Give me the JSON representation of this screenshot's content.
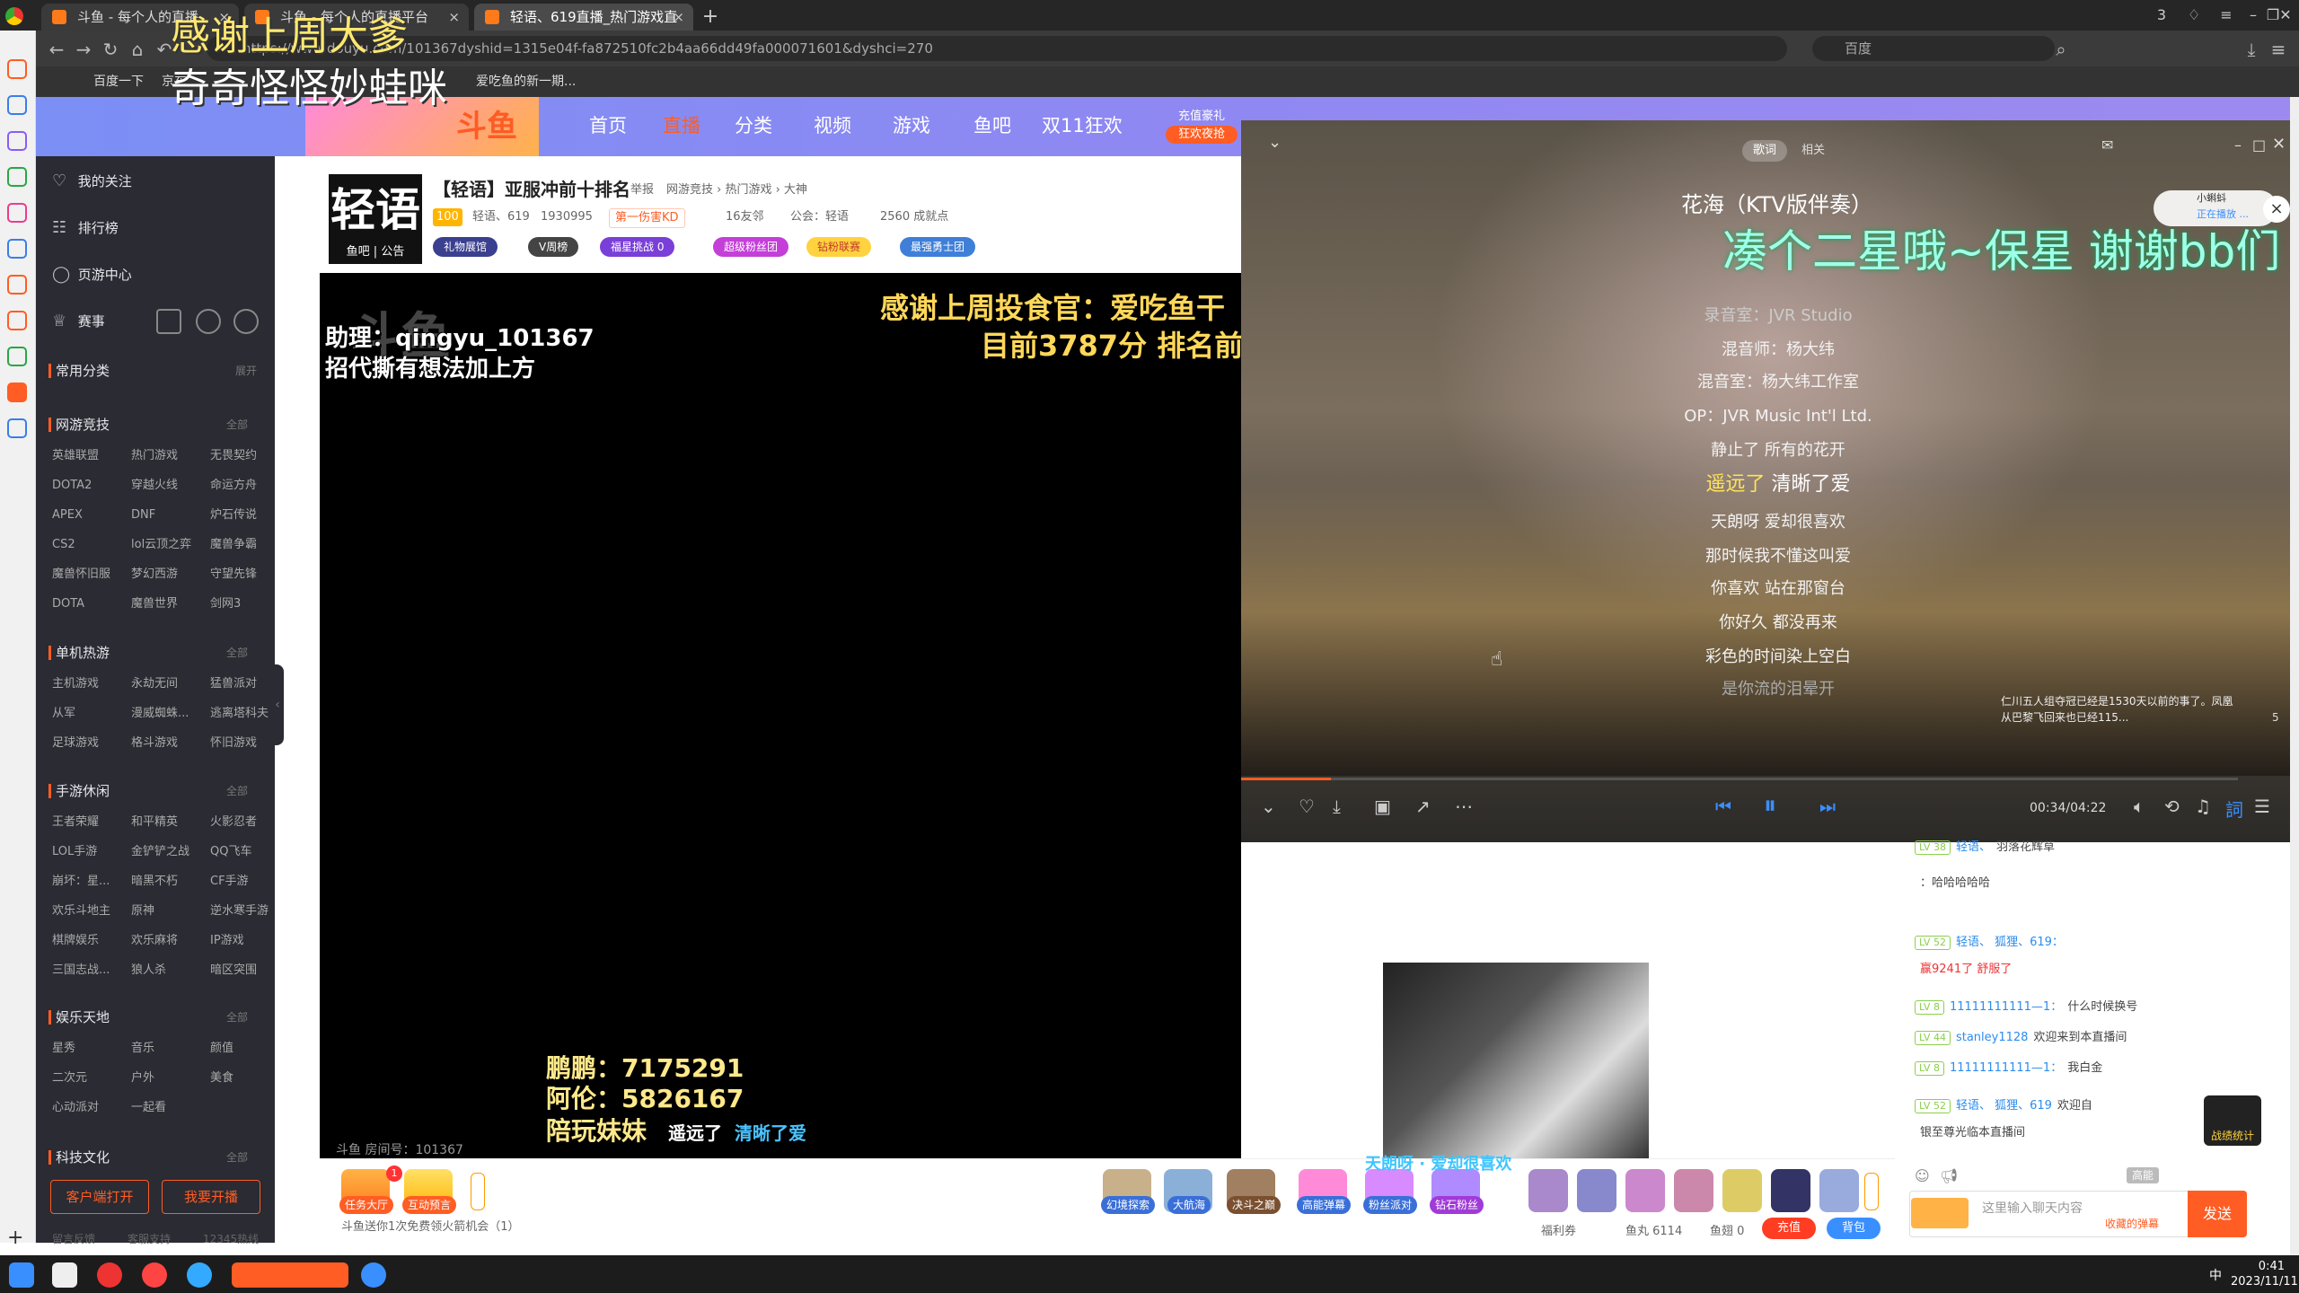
{
  "browser": {
    "tabs": [
      {
        "label": "斗鱼 - 每个人的直播"
      },
      {
        "label": "斗鱼 - 每个人的直播平台"
      },
      {
        "label": "轻语、619直播_热门游戏直"
      }
    ],
    "url": "https://www.douyu.com/101367dyshid=1315e04f-fa872510fc2b4aa66dd49fa000071601&dyshci=270",
    "search_placeholder": "百度",
    "bookmarks": [
      "百度一下",
      "京东",
      "爱吃鱼的新一期..."
    ],
    "tab_count": "3"
  },
  "overlay": {
    "line1": "感谢上周大爹",
    "line2": "奇奇怪怪妙蛙咪"
  },
  "site": {
    "logo": "斗鱼",
    "nav": [
      "首页",
      "直播",
      "分类",
      "视频",
      "游戏",
      "鱼吧",
      "双11狂欢"
    ],
    "promo": [
      "充值豪礼",
      "狂欢夜抢"
    ]
  },
  "sidebar": {
    "top": [
      "我的关注",
      "排行榜",
      "页游中心",
      "赛事"
    ],
    "common": {
      "title": "常用分类",
      "more": "展开"
    },
    "sections": [
      {
        "title": "网游竞技",
        "more": "全部",
        "items": [
          "英雄联盟",
          "热门游戏",
          "无畏契约",
          "DOTA2",
          "穿越火线",
          "命运方舟",
          "APEX",
          "DNF",
          "炉石传说",
          "CS2",
          "lol云顶之弈",
          "魔兽争霸",
          "魔兽怀旧服",
          "梦幻西游",
          "守望先锋",
          "DOTA",
          "魔兽世界",
          "剑网3"
        ]
      },
      {
        "title": "单机热游",
        "more": "全部",
        "items": [
          "主机游戏",
          "永劫无间",
          "猛兽派对",
          "从军",
          "漫威蜘蛛...",
          "逃离塔科夫",
          "足球游戏",
          "格斗游戏",
          "怀旧游戏"
        ]
      },
      {
        "title": "手游休闲",
        "more": "全部",
        "items": [
          "王者荣耀",
          "和平精英",
          "火影忍者",
          "LOL手游",
          "金铲铲之战",
          "QQ飞车",
          "崩坏：星...",
          "暗黑不朽",
          "CF手游",
          "欢乐斗地主",
          "原神",
          "逆水寒手游",
          "棋牌娱乐",
          "欢乐麻将",
          "IP游戏",
          "三国志战...",
          "狼人杀",
          "暗区突围"
        ]
      },
      {
        "title": "娱乐天地",
        "more": "全部",
        "items": [
          "星秀",
          "音乐",
          "颜值",
          "二次元",
          "户外",
          "美食",
          "心动派对",
          "一起看"
        ]
      },
      {
        "title": "科技文化",
        "more": "全部",
        "items": []
      }
    ],
    "client_btn": "客户端打开",
    "live_btn": "我要开播",
    "footer": [
      "留言反馈",
      "客服支持",
      "12345热线"
    ]
  },
  "room": {
    "avatar_text": "轻语",
    "avatar_sub": "鱼吧 | 公告",
    "title": "【轻语】亚服冲前十排名",
    "report": "举报",
    "category": "网游竞技 › 热门游戏 › 大神",
    "level": "100",
    "anchor": "轻语、619",
    "hot": "1930995",
    "rank": "第一伤害KD",
    "friends": "16友邻",
    "guild": "公会：轻语",
    "fans": "2560 成就点",
    "badges": [
      "礼物展馆",
      "V周榜",
      "福星挑战 0",
      "超级粉丝团",
      "钻粉联赛",
      "最强勇士团"
    ]
  },
  "video": {
    "watermark": "斗鱼",
    "gold1": "感谢上周投食官：爱吃鱼干",
    "gold2": "目前3787分 排名前",
    "assist1": "助理：qingyu_101367",
    "assist2": "招代撕有想法加上方",
    "scores": [
      "鹏鹏：7175291",
      "阿伦：5826167",
      "陪玩妹妹"
    ],
    "sub_a": "遥远了",
    "sub_b": "清晰了爱",
    "room_no": "斗鱼 房间号：101367",
    "top_sub": "天朗呀 · 爱却很喜欢"
  },
  "player": {
    "tabs": [
      "歌词",
      "相关"
    ],
    "title": "花海（KTV版伴奏）",
    "lyric_big": "凑个二星哦~保星  谢谢bb们",
    "lyrics": [
      "录音室：JVR Studio",
      "混音师：杨大纬",
      "混音室：杨大纬工作室",
      "OP：JVR Music Int'l Ltd.",
      "静止了 所有的花开",
      "天朗呀 爱却很喜欢",
      "那时候我不懂这叫爱",
      "你喜欢 站在那窗台",
      "你好久 都没再来",
      "彩色的时间染上空白",
      "是你流的泪晕开"
    ],
    "lyric_hl_a": "遥远了",
    "lyric_hl_b": " 清晰了爱",
    "time": "00:34/04:22",
    "notice": "仁川五人组夺冠已经是1530天以前的事了。凤凰从巴黎飞回来也已经115...",
    "notice_count": "5",
    "mini_tag": "小蝌蚪",
    "mini_sub": "正在播放 ..."
  },
  "chat": {
    "messages": [
      {
        "lv": "LV 38",
        "name": "轻语、",
        "text": "羽落花辉草"
      },
      {
        "lv": "",
        "name": "",
        "text": "：哈哈哈哈哈"
      },
      {
        "lv": "LV 52",
        "name": "轻语、 狐狸、619：",
        "text": ""
      },
      {
        "lv": "",
        "name": "",
        "text": "赢9241了 舒服了"
      },
      {
        "lv": "LV 8",
        "name": "11111111111—1：",
        "text": "什么时候换号"
      },
      {
        "lv": "LV 44",
        "name": "stanley1128",
        "text": "欢迎来到本直播间"
      },
      {
        "lv": "LV 8",
        "name": "11111111111—1：",
        "text": "我白金"
      },
      {
        "lv": "LV 52",
        "name": "轻语、 狐狸、619",
        "text": "欢迎自"
      },
      {
        "lv": "",
        "name": "",
        "text": "银至尊光临本直播间"
      }
    ],
    "input_placeholder": "这里输入聊天内容",
    "send": "发送",
    "collect": "收藏的弹幕",
    "level_btn": "高能",
    "event": "战绩统计"
  },
  "gifts": {
    "left": [
      {
        "label": "任务大厅",
        "badge": "1"
      },
      {
        "label": "互动预言"
      }
    ],
    "right": [
      "幻境探索",
      "大航海",
      "决斗之巅",
      "高能弹幕",
      "粉丝派对",
      "钻石粉丝"
    ],
    "free_text": "斗鱼送你1次免费领火箭机会（1）",
    "welfare": "福利券",
    "fish_ball": "鱼丸 6114",
    "fish_chi": "鱼翅 0",
    "recharge": "充值",
    "backpack": "背包"
  },
  "taskbar": {
    "time": "0:41",
    "date": "2023/11/11",
    "lang": "中"
  }
}
